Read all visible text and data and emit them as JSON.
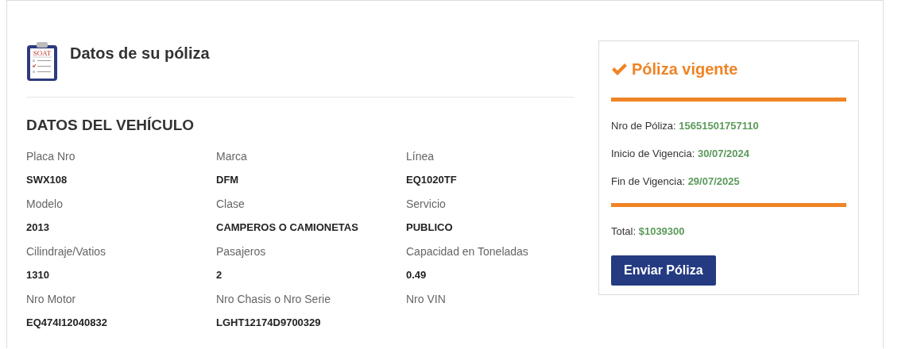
{
  "header": {
    "icon_label": "SOAT",
    "title": "Datos de su póliza"
  },
  "vehicle": {
    "title": "DATOS DEL VEHÍCULO",
    "fields": [
      {
        "label": "Placa Nro",
        "value": "SWX108"
      },
      {
        "label": "Marca",
        "value": "DFM"
      },
      {
        "label": "Línea",
        "value": "EQ1020TF"
      },
      {
        "label": "Modelo",
        "value": "2013"
      },
      {
        "label": "Clase",
        "value": "CAMPEROS O CAMIONETAS"
      },
      {
        "label": "Servicio",
        "value": "PUBLICO"
      },
      {
        "label": "Cilindraje/Vatios",
        "value": "1310"
      },
      {
        "label": "Pasajeros",
        "value": "2"
      },
      {
        "label": "Capacidad en Toneladas",
        "value": "0.49"
      },
      {
        "label": "Nro Motor",
        "value": "EQ474I12040832"
      },
      {
        "label": "Nro Chasis o Nro Serie",
        "value": "LGHT12174D9700329"
      },
      {
        "label": "Nro VIN"
      }
    ]
  },
  "policy": {
    "status": "Póliza vigente",
    "details": [
      {
        "label": "Nro de Póliza:",
        "value": "15651501757110"
      },
      {
        "label": "Inicio de Vigencia:",
        "value": "30/07/2024"
      },
      {
        "label": "Fin de Vigencia:",
        "value": "29/07/2025"
      }
    ],
    "total": {
      "label": "Total:",
      "value": "$1039300"
    },
    "button": "Enviar Póliza"
  }
}
